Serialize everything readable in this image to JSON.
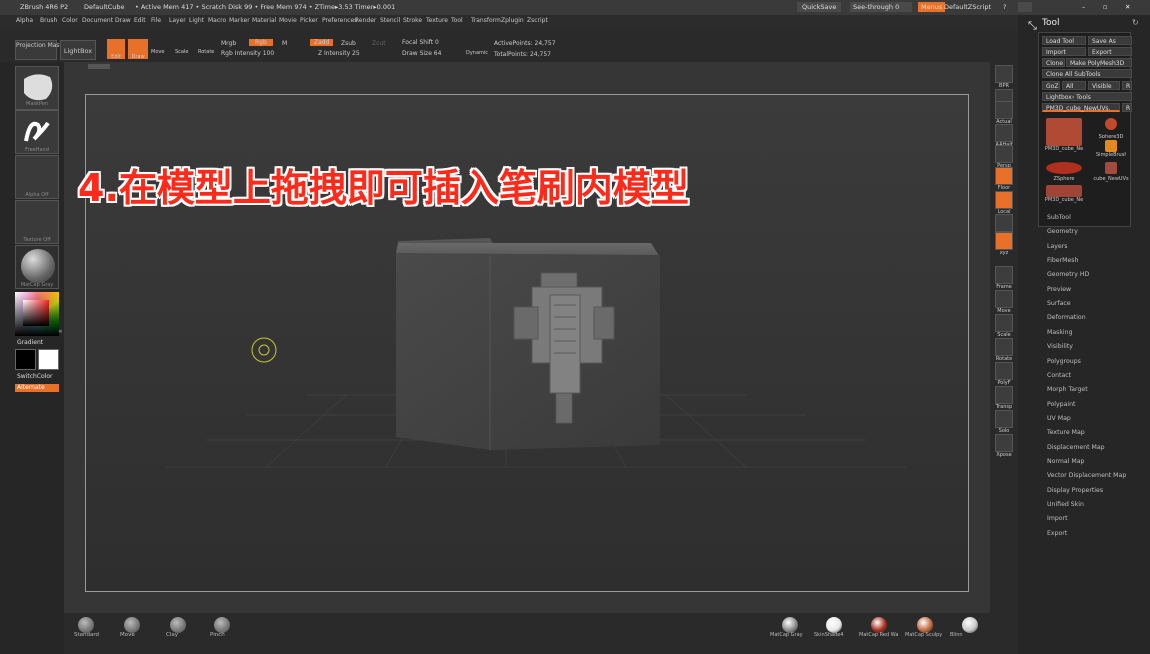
{
  "titlebar": {
    "app": "ZBrush 4R6 P2",
    "doc": "DefaultCube",
    "stats": "• Active Mem 417 • Scratch Disk 99 • Free Mem 974 • ZTime▸3.53 Timer▸0.001",
    "quicksave": "QuickSave",
    "seethrough": "See-through  0",
    "menus": "Menus",
    "zscript": "DefaultZScript"
  },
  "menubar": [
    "Alpha",
    "Brush",
    "Color",
    "Document",
    "Draw",
    "Edit",
    "File",
    "Layer",
    "Light",
    "Macro",
    "Marker",
    "Material",
    "Movie",
    "Picker",
    "Preferences",
    "Render",
    "Stencil",
    "Stroke",
    "Texture",
    "Tool",
    "Transform",
    "Zplugin",
    "Zscript"
  ],
  "topctrl": {
    "projection_master": "Projection Master",
    "lightbox": "LightBox",
    "edit": "Edit",
    "draw": "Draw",
    "move": "Move",
    "scale": "Scale",
    "rotate": "Rotate",
    "mrgb": "Mrgb",
    "rgb": "Rgb",
    "m": "M",
    "rgb_intensity": "Rgb Intensity 100",
    "zadd": "Zadd",
    "zsub": "Zsub",
    "zcut": "Zcut",
    "z_intensity": "Z Intensity 25",
    "focal_shift": "Focal Shift 0",
    "draw_size": "Draw Size 64",
    "dynamic": "Dynamic",
    "active_points": "ActivePoints: 24,757",
    "total_points": "TotalPoints: 24,757"
  },
  "leftpanel": {
    "brush": "MaskPen",
    "stroke": "FreeHand",
    "alpha": "Alpha Off",
    "texture": "Texture Off",
    "material": "MatCap Gray",
    "gradient": "Gradient",
    "switchcolor": "SwitchColor",
    "alternate": "Alternate"
  },
  "overlay_text": "4.在模型上拖拽即可插入笔刷内模型",
  "shelf": [
    {
      "label": "Standard"
    },
    {
      "label": "Move"
    },
    {
      "label": "Clay"
    },
    {
      "label": "Pinch"
    }
  ],
  "materials": [
    {
      "label": "MatCap Gray",
      "color": "#8a8a8a"
    },
    {
      "label": "SkinShade4",
      "color": "#e8e8e8"
    },
    {
      "label": "MatCap Red Wa",
      "color": "#a83020"
    },
    {
      "label": "MatCap Sculpy",
      "color": "#c06a40"
    },
    {
      "label": "Blinn",
      "color": "#c8c8c8"
    }
  ],
  "rightshelf": [
    "BPR",
    "SPix",
    "Actual",
    "AAHalf",
    "Persp",
    "Floor",
    "Local",
    "L.Sym",
    "xyz",
    "Frame",
    "Move",
    "Scale",
    "Rotate",
    "PolyF",
    "Transp",
    "Solo",
    "Xpose"
  ],
  "toolpanel": {
    "title": "Tool",
    "load_tool": "Load Tool",
    "save_as": "Save As",
    "import": "Import",
    "export": "Export",
    "clone": "Clone",
    "make_polymesh": "Make PolyMesh3D",
    "clone_all": "Clone All SubTools",
    "goz": "GoZ",
    "all": "All",
    "visible": "Visible",
    "r": "R",
    "lightbox_tools": "Lightbox› Tools",
    "current_tool": "PM3D_cube_NewUVs.",
    "thumbs": [
      {
        "label": "PM3D_cube_Ne",
        "color": "#b04a35"
      },
      {
        "label": "Sphere3D",
        "color": "#c24a2a"
      },
      {
        "label": "SimpleBrush",
        "color": "#e08a20"
      },
      {
        "label": "ZSphere",
        "color": "#b03020"
      },
      {
        "label": "cube_NewUVs",
        "color": "#a04a40"
      },
      {
        "label": "PM3D_cube_Ne",
        "color": "#a04535"
      }
    ],
    "subpalettes": [
      "SubTool",
      "Geometry",
      "Layers",
      "FiberMesh",
      "Geometry HD",
      "Preview",
      "Surface",
      "Deformation",
      "Masking",
      "Visibility",
      "Polygroups",
      "Contact",
      "Morph Target",
      "Polypaint",
      "UV Map",
      "Texture Map",
      "Displacement Map",
      "Normal Map",
      "Vector Displacement Map",
      "Display Properties",
      "Unified Skin",
      "Import",
      "Export"
    ]
  },
  "accent": "#e8712a"
}
